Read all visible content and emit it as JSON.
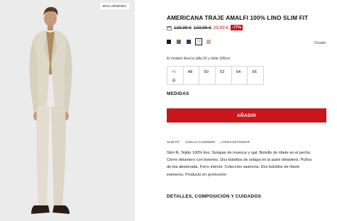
{
  "product": {
    "badge": "MÁS VENDIDO",
    "title": "AMERICANA TRAJE AMALFI 100% LINO SLIM FIT",
    "price_original": "129,99 €",
    "price_previous": "103,99 €",
    "price_sale": "29,99 €",
    "discount": "-77%",
    "swatches": [
      {
        "color": "#1a1a1a",
        "selected": false
      },
      {
        "color": "#6b6b6b",
        "selected": false
      },
      {
        "color": "#2f3e5a",
        "selected": false
      },
      {
        "color": "#e6e1d4",
        "selected": true
      },
      {
        "color": "#c9b595",
        "selected": false
      }
    ],
    "color_name": "Crudo",
    "model_note": "El modelo lleva la talla 50 y mide 185cm.",
    "sizes": [
      {
        "label": "46",
        "notify": true
      },
      {
        "label": "48",
        "notify": false
      },
      {
        "label": "50",
        "notify": false
      },
      {
        "label": "52",
        "notify": false
      },
      {
        "label": "54",
        "notify": false
      },
      {
        "label": "56",
        "notify": false
      }
    ],
    "measures_label": "MEDIDAS",
    "add_label": "AÑADIR",
    "tags": [
      "SLIM FIT",
      "CUELLO CAMISERO",
      "LARGO ESTÁNDAR"
    ],
    "description": "Slim fit. Tejido 100% lino. Solapas de muesca y ojal. Bolsillo de ribete en el pecho. Cierre delantero con botones. Dos bolsillos de solapa en la parte delantera. Puños de tira abotonada. Forro interior. Colección sastrería. Dos bolsillos de ribete interiores. Producto en promoción",
    "details_label": "DETALLES, COMPOSICIÓN Y CUIDADOS"
  },
  "colors": {
    "accent": "#c8161d",
    "photo_bg": "#ececec"
  }
}
